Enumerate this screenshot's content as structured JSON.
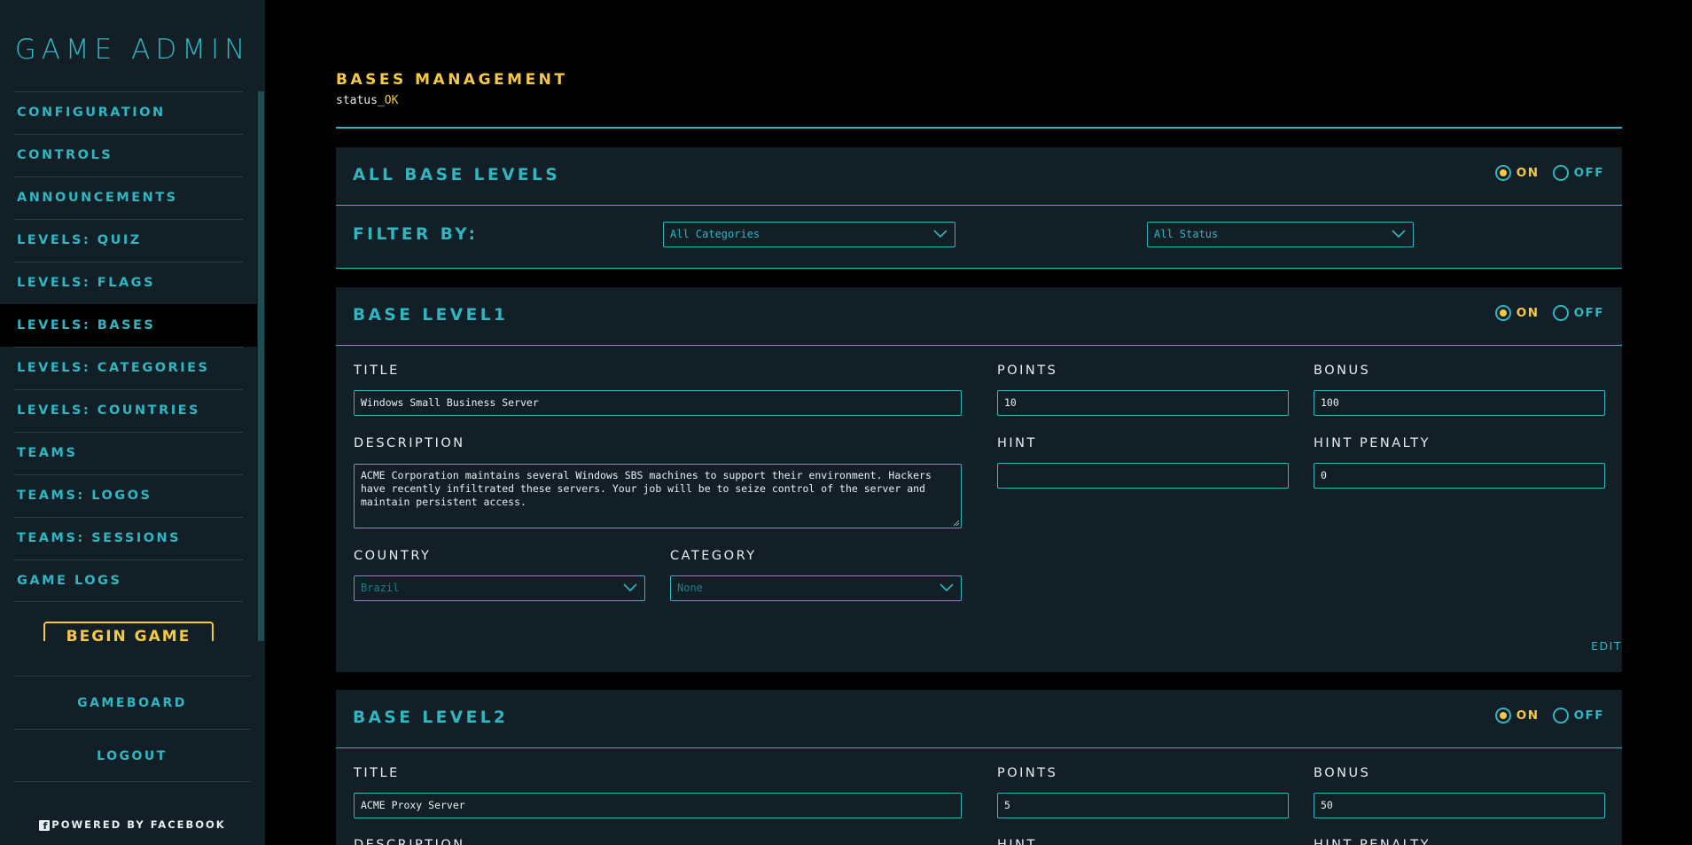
{
  "sidebar": {
    "brand": "GAME ADMIN",
    "nav": [
      {
        "label": "CONFIGURATION"
      },
      {
        "label": "CONTROLS"
      },
      {
        "label": "ANNOUNCEMENTS"
      },
      {
        "label": "LEVELS: QUIZ"
      },
      {
        "label": "LEVELS: FLAGS"
      },
      {
        "label": "LEVELS: BASES"
      },
      {
        "label": "LEVELS: CATEGORIES"
      },
      {
        "label": "LEVELS: COUNTRIES"
      },
      {
        "label": "TEAMS"
      },
      {
        "label": "TEAMS: LOGOS"
      },
      {
        "label": "TEAMS: SESSIONS"
      },
      {
        "label": "GAME LOGS"
      }
    ],
    "active_item": "LEVELS: BASES",
    "begin_game": "BEGIN GAME",
    "gameboard": "GAMEBOARD",
    "logout": "LOGOUT",
    "powered_by": "POWERED BY FACEBOOK",
    "fb_icon": "facebook-icon"
  },
  "header": {
    "title": "BASES MANAGEMENT",
    "status_prefix": "status_",
    "status_value": "OK"
  },
  "all_levels": {
    "title": "ALL BASE LEVELS",
    "on_label": "ON",
    "off_label": "OFF",
    "state": "on",
    "filter_label": "FILTER BY:",
    "category_filter": "All Categories",
    "status_filter": "All Status"
  },
  "labels": {
    "title": "TITLE",
    "points": "POINTS",
    "bonus": "BONUS",
    "description": "DESCRIPTION",
    "hint": "HINT",
    "hint_penalty": "HINT PENALTY",
    "country": "COUNTRY",
    "category": "CATEGORY",
    "edit": "EDIT",
    "on": "ON",
    "off": "OFF"
  },
  "levels": [
    {
      "name": "BASE LEVEL1",
      "state": "on",
      "title": "Windows Small Business Server",
      "points": "10",
      "bonus": "100",
      "description": "ACME Corporation maintains several Windows SBS machines to support their environment. Hackers have recently infiltrated these servers. Your job will be to seize control of the server and maintain persistent access.",
      "hint": "",
      "hint_penalty": "0",
      "country": "Brazil",
      "category": "None"
    },
    {
      "name": "BASE LEVEL2",
      "state": "on",
      "title": "ACME Proxy Server",
      "points": "5",
      "bonus": "50"
    }
  ],
  "colors": {
    "accent": "#2fb6c1",
    "highlight": "#f5c944",
    "panel": "#131f26",
    "background": "#000000"
  }
}
